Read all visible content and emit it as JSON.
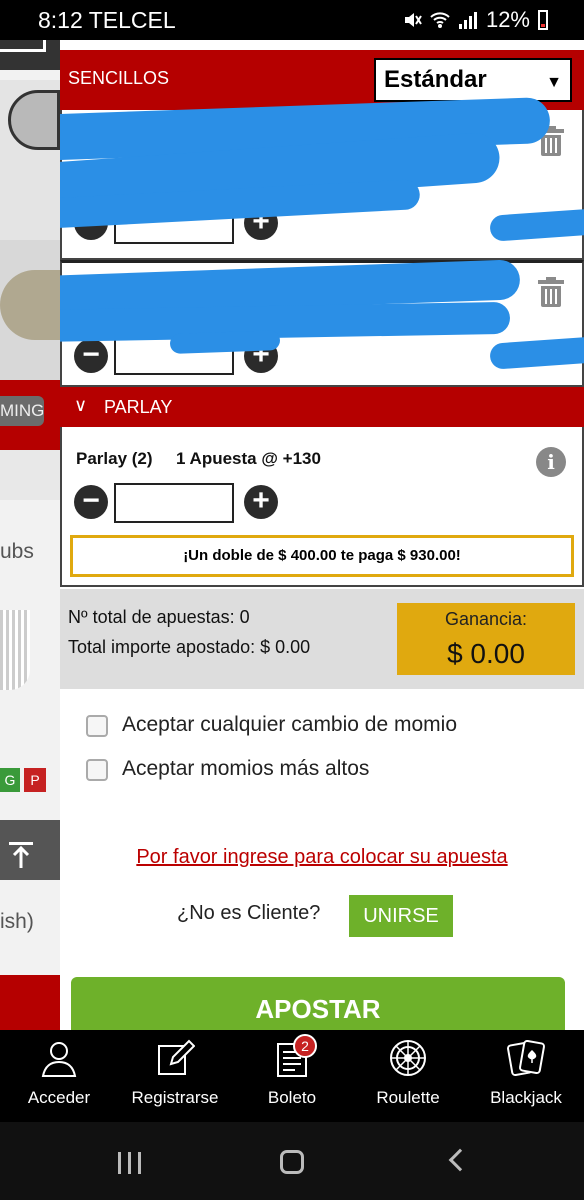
{
  "status_bar": {
    "time": "8:12",
    "carrier": "TELCEL",
    "battery": "12%"
  },
  "background_page": {
    "pill_text": "MING",
    "text_1": "ubs",
    "badge_g": "G",
    "badge_p": "P",
    "text_2": "ish)"
  },
  "bet_slip": {
    "singles_header": "SENCILLOS",
    "bet_type_select": "Estándar",
    "parlay_header": "PARLAY",
    "parlay": {
      "title": "Parlay (2)",
      "subtitle": "1 Apuesta @ +130",
      "promo": "¡Un doble de $ 400.00 te paga $ 930.00!"
    },
    "summary": {
      "total_bets": "Nº total de apuestas: 0",
      "total_amount": "Total importe apostado: $ 0.00",
      "gain_label": "Ganancia:",
      "gain_value": "$ 0.00"
    },
    "options": {
      "accept_any_change": "Aceptar cualquier cambio de momio",
      "accept_higher_odds": "Aceptar momios más altos"
    },
    "login_prompt": "Por favor ingrese para colocar su apuesta",
    "not_client": "¿No es Cliente?",
    "join_button": "UNIRSE",
    "place_bet_button": "APOSTAR"
  },
  "bottom_nav": {
    "items": [
      {
        "label": "Acceder",
        "icon": "user-icon"
      },
      {
        "label": "Registrarse",
        "icon": "edit-icon"
      },
      {
        "label": "Boleto",
        "icon": "ticket-icon"
      },
      {
        "label": "Roulette",
        "icon": "roulette-icon"
      },
      {
        "label": "Blackjack",
        "icon": "cards-icon"
      }
    ],
    "ticket_badge": "2"
  },
  "colors": {
    "header_red": "#b50000",
    "gain_gold": "#e0a90f",
    "button_green": "#6eb12a"
  }
}
